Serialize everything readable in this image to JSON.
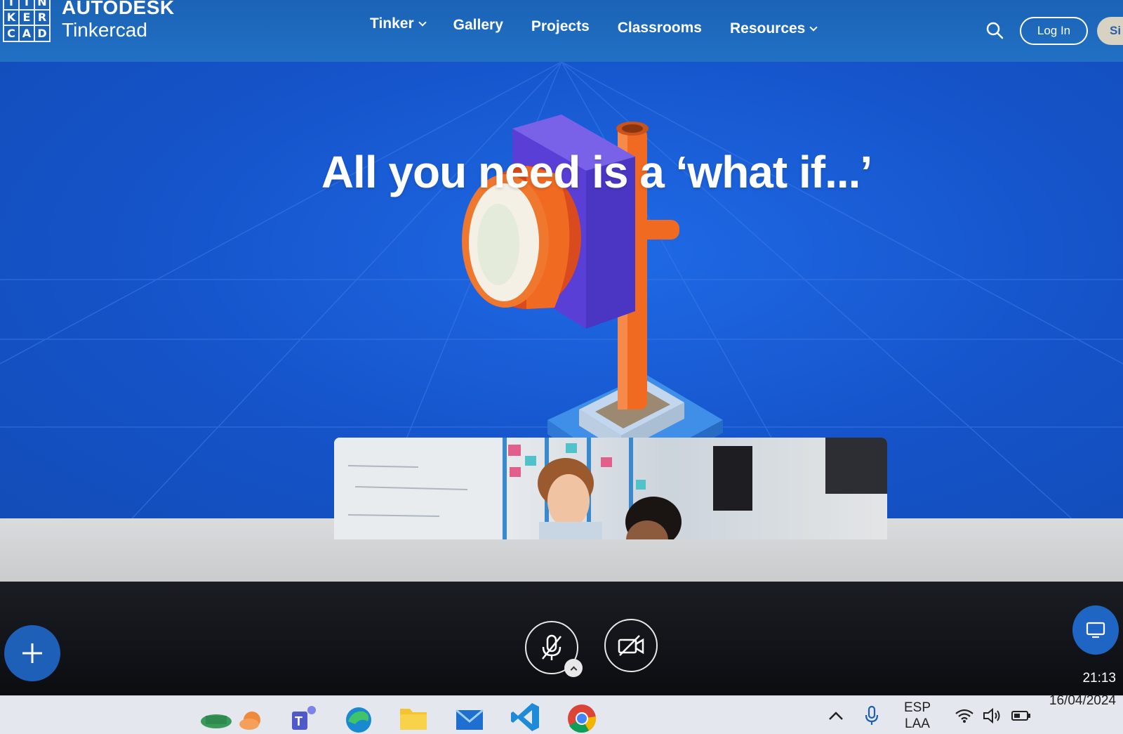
{
  "nav": {
    "logo_letters": [
      "T",
      "I",
      "N",
      "K",
      "E",
      "R",
      "C",
      "A",
      "D"
    ],
    "company": "AUTODESK",
    "product": "Tinkercad",
    "links": [
      {
        "label": "Tinker",
        "dropdown": true
      },
      {
        "label": "Gallery",
        "dropdown": false
      },
      {
        "label": "Projects",
        "dropdown": false
      },
      {
        "label": "Classrooms",
        "dropdown": false
      },
      {
        "label": "Resources",
        "dropdown": true
      }
    ],
    "login_label": "Log In",
    "signup_label": "Si"
  },
  "hero": {
    "headline": "All you need is a ‘what if...’"
  },
  "meeting_toolbar": {
    "mic_icon": "mic-muted-icon",
    "camera_icon": "camera-off-icon",
    "add_icon": "plus-icon",
    "screen_icon": "screen-share-icon"
  },
  "taskbar": {
    "apps": [
      "cooking-pot-icon",
      "weather-icon",
      "teams-icon",
      "edge-icon",
      "file-explorer-icon",
      "mail-icon",
      "vscode-icon",
      "chrome-icon"
    ],
    "language_top": "ESP",
    "language_bottom": "LAA",
    "time": "21:13",
    "date": "16/04/2024"
  },
  "colors": {
    "nav_blue": "#1b63b6",
    "hero_blue": "#1553c9",
    "accent_orange": "#f06a22",
    "purple_block": "#5a3fd6"
  }
}
